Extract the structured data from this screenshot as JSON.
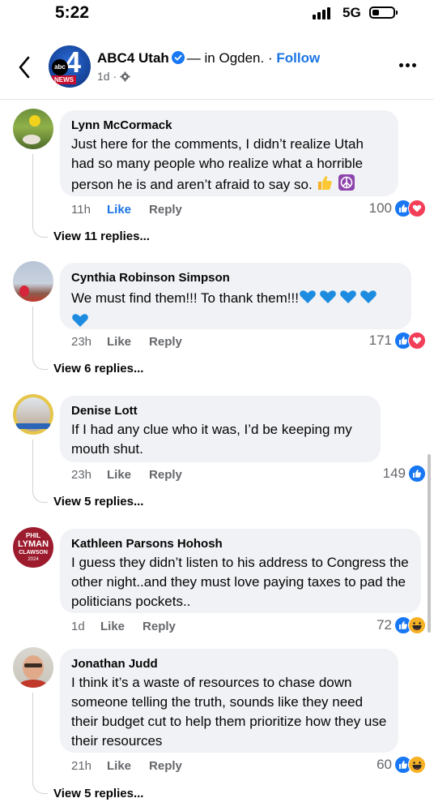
{
  "status_bar": {
    "time": "5:22",
    "network": "5G"
  },
  "header": {
    "page_name": "ABC4 Utah",
    "location_text": "— in Ogden.",
    "separator": "·",
    "follow_label": "Follow",
    "timestamp": "1d",
    "logo_number": "4",
    "logo_abc": "abc",
    "logo_news": "NEWS"
  },
  "comments": [
    {
      "name": "Lynn McCormack",
      "text": "Just here for the comments, I didn’t realize Utah had so many people who realize what a horrible person he is and aren’t afraid to say so.",
      "time": "11h",
      "like_label": "Like",
      "reply_label": "Reply",
      "reaction_count": "100",
      "reactions": [
        "like",
        "love"
      ],
      "replies_label": "View 11 replies..."
    },
    {
      "name": "Cynthia Robinson Simpson",
      "text": "We must find them!!! To thank them!!!",
      "time": "23h",
      "like_label": "Like",
      "reply_label": "Reply",
      "reaction_count": "171",
      "reactions": [
        "like",
        "love"
      ],
      "replies_label": "View 6 replies..."
    },
    {
      "name": "Denise Lott",
      "text": "If I had any clue who it was, I’d be keeping my mouth shut.",
      "time": "23h",
      "like_label": "Like",
      "reply_label": "Reply",
      "reaction_count": "149",
      "reactions": [
        "like"
      ],
      "replies_label": "View 5 replies..."
    },
    {
      "name": "Kathleen Parsons Hohosh",
      "text": "I guess they didn’t listen to his address to Congress the other night..and they must love paying taxes to pad the politicians pockets..",
      "time": "1d",
      "like_label": "Like",
      "reply_label": "Reply",
      "reaction_count": "72",
      "reactions": [
        "like",
        "haha"
      ],
      "avatar_text": {
        "top": "PHIL",
        "mid": "LYMAN",
        "bottom": "CLAWSON",
        "year": "2024"
      }
    },
    {
      "name": "Jonathan Judd",
      "text": "I think it’s a waste of resources to chase down someone telling the truth, sounds like they need their budget cut to help them prioritize how they use their resources",
      "time": "21h",
      "like_label": "Like",
      "reply_label": "Reply",
      "reaction_count": "60",
      "reactions": [
        "like",
        "haha"
      ],
      "replies_label": "View 5 replies..."
    }
  ],
  "colors": {
    "accent": "#1b74e4",
    "bubble": "#f0f2f5",
    "meta": "#65676b"
  }
}
